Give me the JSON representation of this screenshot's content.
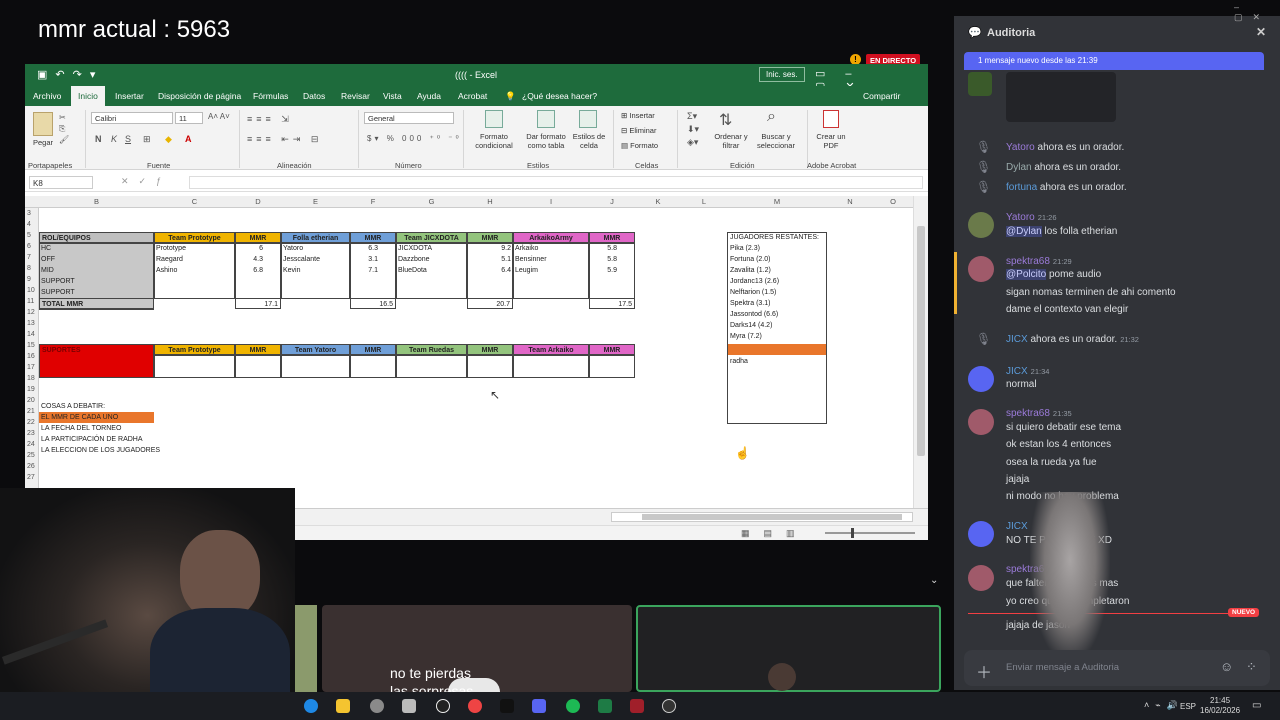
{
  "overlay": {
    "mmr_text": "mmr actual : 5963",
    "live_badge": "EN DIRECTO"
  },
  "excel": {
    "title": "(((( - Excel",
    "sign_in": "Inic. ses.",
    "tabs": [
      "Archivo",
      "Inicio",
      "Insertar",
      "Disposición de página",
      "Fórmulas",
      "Datos",
      "Revisar",
      "Vista",
      "Ayuda",
      "Acrobat",
      "¿Qué desea hacer?"
    ],
    "share": "Compartir",
    "ribbon": {
      "paste": "Pegar",
      "font_name": "Calibri",
      "font_size": "11",
      "number_format": "General",
      "cond_format": "Formato condicional",
      "as_table": "Dar formato como tabla",
      "cell_styles": "Estilos de celda",
      "insert": "Insertar",
      "delete": "Eliminar",
      "format": "Formato",
      "sort": "Ordenar y filtrar",
      "find": "Buscar y seleccionar",
      "pdf": "Crear un PDF",
      "groups": [
        "Portapapeles",
        "Fuente",
        "Alineación",
        "Número",
        "Estilos",
        "Celdas",
        "Edición",
        "Adobe Acrobat"
      ]
    },
    "name_box": "K8",
    "columns": [
      "B",
      "C",
      "D",
      "E",
      "F",
      "G",
      "H",
      "I",
      "J",
      "K",
      "L",
      "M",
      "N",
      "O"
    ],
    "rows": [
      "3",
      "4",
      "5",
      "6",
      "7",
      "8",
      "9",
      "10",
      "11",
      "12",
      "13",
      "14",
      "15",
      "16",
      "17",
      "18",
      "19",
      "20",
      "21",
      "22",
      "23",
      "24",
      "25",
      "26",
      "27"
    ],
    "teams_header": {
      "rol": "ROL/EQUIPOS",
      "t1": "Team Prototype",
      "mmr": "MMR",
      "t2": "Folla etherian",
      "t3": "Team JICXDOTA",
      "t4": "ArkaikoArmy"
    },
    "roles": [
      "HC",
      "OFF",
      "MID",
      "SUPPORT",
      "SUPPORT"
    ],
    "total_label": "TOTAL MMR",
    "team1": [
      {
        "name": "Prototype",
        "mmr": "6"
      },
      {
        "name": "Raegard",
        "mmr": "4.3"
      },
      {
        "name": "Ashino",
        "mmr": "6.8"
      }
    ],
    "team2": [
      {
        "name": "Yatoro",
        "mmr": "6.3"
      },
      {
        "name": "Jesscalante",
        "mmr": "3.1"
      },
      {
        "name": "Kevin",
        "mmr": "7.1"
      }
    ],
    "team3": [
      {
        "name": "JICXDOTA",
        "mmr": "9.2"
      },
      {
        "name": "Dazzbone",
        "mmr": "5.1"
      },
      {
        "name": "BlueDota",
        "mmr": "6.4"
      }
    ],
    "team4": [
      {
        "name": "Arkaiko",
        "mmr": "5.8"
      },
      {
        "name": "Bensinner",
        "mmr": "5.8"
      },
      {
        "name": "Leugim",
        "mmr": "5.9"
      }
    ],
    "totals": [
      "17.1",
      "16.5",
      "20.7",
      "17.5"
    ],
    "support_header": {
      "sup": "SUPORTES",
      "t1": "Team Prototype",
      "t2": "Team Yatoro",
      "t3": "Team Ruedas",
      "t4": "Team Arkaiko",
      "mmr": "MMR"
    },
    "debate": {
      "title": "COSAS A DEBATIR:",
      "items": [
        "EL MMR DE CADA UNO",
        "LA FECHA DEL TORNEO",
        "LA PARTICIPACIÓN DE RADHA",
        "LA ELECCION DE LOS JUGADORES"
      ]
    },
    "remaining": {
      "title": "JUGADORES RESTANTES:",
      "players": [
        "Pika (2.3)",
        "Fortuna (2.0)",
        "Zavalita (1.2)",
        "Jordanc13 (2.6)",
        "Nelftarion (1.5)",
        "Spektra (3.1)",
        "Jassontod (6.6)",
        "Darks14 (4.2)",
        "Myra (7.2)"
      ],
      "extra": "radha"
    }
  },
  "chat": {
    "channel": "Auditoria",
    "new_banner": "1 mensaje nuevo desde las 21:39",
    "messages": [
      {
        "kind": "system",
        "user": "Yatoro",
        "text": "ahora es un orador."
      },
      {
        "kind": "system",
        "user": "Dylan",
        "text": "ahora es un orador."
      },
      {
        "kind": "system",
        "user": "fortuna",
        "text": "ahora es un orador."
      },
      {
        "kind": "msg",
        "user": "Yatoro",
        "time": "21:26",
        "mention": "@Dylan",
        "text": "los folla etherian"
      },
      {
        "kind": "msg",
        "user": "spektra68",
        "time": "21:29",
        "mention": "@Polcito",
        "text": "pome audio"
      },
      {
        "kind": "line",
        "text": "sigan nomas terminen de ahi comento"
      },
      {
        "kind": "line",
        "text": "dame el contexto van elegir"
      },
      {
        "kind": "system",
        "user": "JICX",
        "text": "ahora es un orador.",
        "time": "21:32"
      },
      {
        "kind": "msg",
        "user": "JICX",
        "time": "21:34",
        "text": "normal"
      },
      {
        "kind": "msg",
        "user": "spektra68",
        "time": "21:35",
        "text": "si quiero debatir ese tema"
      },
      {
        "kind": "line",
        "text": "ok estan los 4 entonces"
      },
      {
        "kind": "line",
        "text": "osea la rueda ya fue"
      },
      {
        "kind": "line",
        "text": "jajaja"
      },
      {
        "kind": "line",
        "text": "ni modo no hay problema"
      },
      {
        "kind": "msg",
        "user": "JICX",
        "time": "",
        "text": "NO TE PREOCUPE XD"
      },
      {
        "kind": "msg",
        "user": "spektra68",
        "time": "",
        "text": "que falten jugadores mas"
      },
      {
        "kind": "line",
        "text": "yo creo que se completaron"
      },
      {
        "kind": "line",
        "text": "jajaja de jason"
      }
    ],
    "nuevo": "NUEVO",
    "input_placeholder": "Enviar mensaje a Auditoria"
  },
  "caption": {
    "line1": "no te pierdas",
    "line2": "las sorpresas"
  },
  "taskbar": {
    "lang": "ESP",
    "time": "21:45",
    "date": "16/02/2026"
  }
}
